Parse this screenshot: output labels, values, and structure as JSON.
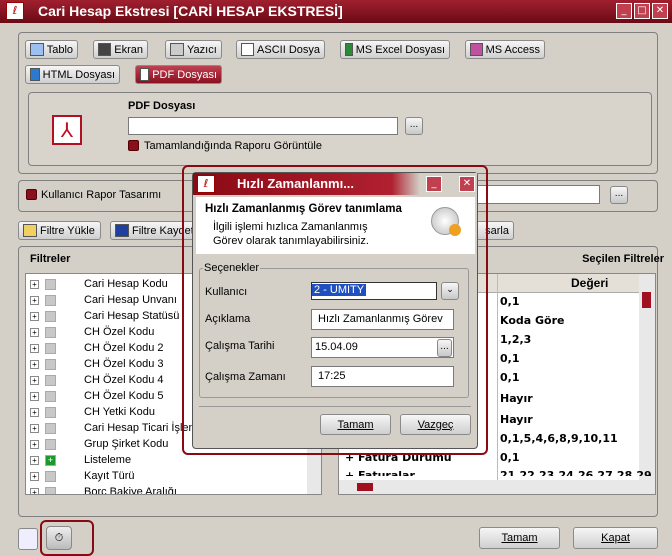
{
  "window": {
    "title": "Cari Hesap Ekstresi [CARİ HESAP EKSTRESİ]"
  },
  "output_buttons": [
    {
      "label": "Tablo",
      "icon": "table-icon"
    },
    {
      "label": "Ekran",
      "icon": "monitor-icon"
    },
    {
      "label": "Yazıcı",
      "icon": "printer-icon"
    },
    {
      "label": "ASCII Dosya",
      "icon": "text-file-icon"
    },
    {
      "label": "MS Excel Dosyası",
      "icon": "excel-icon"
    },
    {
      "label": "MS Access",
      "icon": "access-icon"
    },
    {
      "label": "HTML Dosyası",
      "icon": "globe-icon"
    },
    {
      "label": "PDF Dosyası",
      "icon": "pdf-icon",
      "selected": true
    }
  ],
  "pdf": {
    "label": "PDF Dosyası",
    "path": "",
    "browse": "...",
    "show_when_done": "Tamamlandığında Raporu Görüntüle",
    "show_when_done_checked": true
  },
  "design": {
    "label": "Kullanıcı Rapor Tasarımı",
    "checked": true,
    "value": "",
    "browse": "..."
  },
  "filter_buttons": {
    "load": "Filtre Yükle",
    "save": "Filtre Kaydet",
    "design_partial": "sarla"
  },
  "filters": {
    "title": "Filtreler",
    "items": [
      {
        "label": "Cari Hesap Kodu"
      },
      {
        "label": "Cari Hesap Unvanı"
      },
      {
        "label": "Cari Hesap Statüsü"
      },
      {
        "label": "CH Özel Kodu"
      },
      {
        "label": "CH Özel Kodu 2"
      },
      {
        "label": "CH Özel Kodu 3"
      },
      {
        "label": "CH Özel Kodu 4"
      },
      {
        "label": "CH Özel Kodu 5"
      },
      {
        "label": "CH Yetki Kodu"
      },
      {
        "label": "Cari Hesap Ticari İşlem"
      },
      {
        "label": "Grup Şirket Kodu"
      },
      {
        "label": "Listeleme",
        "active": true
      },
      {
        "label": "Kayıt Türü"
      },
      {
        "label": "Borç Bakiye Aralığı"
      }
    ]
  },
  "selected_filters": {
    "title": "Seçilen Filtreler",
    "value_header": "Değeri",
    "rows": [
      {
        "name": "",
        "value": "0,1"
      },
      {
        "name": "",
        "value": "Koda Göre"
      },
      {
        "name": "",
        "value": "1,2,3"
      },
      {
        "name": "",
        "value": "0,1"
      },
      {
        "name": "",
        "value": "0,1"
      },
      {
        "name": "",
        "value": "Hayır"
      },
      {
        "name": "",
        "value": "Hayır"
      },
      {
        "name": "",
        "value": "0,1,5,4,6,8,9,10,11"
      },
      {
        "name": "Fatura Durumu",
        "value": "0,1"
      },
      {
        "name": "Faturalar",
        "value": "21,22,23,24,26,27,28,29,..."
      }
    ]
  },
  "footer": {
    "ok": "Tamam",
    "close": "Kapat"
  },
  "dialog": {
    "title": "Hızlı Zamanlanmı...",
    "header": "Hızlı Zamanlanmış Görev tanımlama",
    "desc": "İlgili işlemi hızlıca Zamanlanmış Görev olarak tanımlayabilirsiniz.",
    "group": "Seçenekler",
    "user_label": "Kullanıcı",
    "user_value": "2 - UMITY",
    "desc_label": "Açıklama",
    "desc_value": "Hızlı Zamanlanmış Görev",
    "date_label": "Çalışma Tarihi",
    "date_value": "15.04.09",
    "time_label": "Çalışma Zamanı",
    "time_value": "17:25",
    "ok": "Tamam",
    "cancel": "Vazgeç"
  }
}
